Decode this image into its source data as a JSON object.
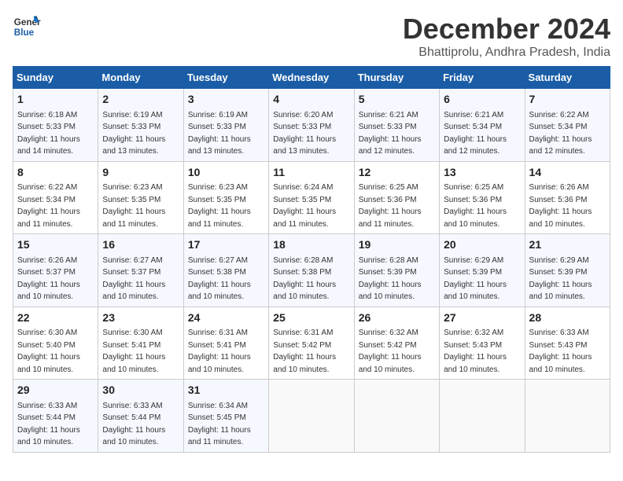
{
  "header": {
    "logo_general": "General",
    "logo_blue": "Blue",
    "month_title": "December 2024",
    "location": "Bhattiprolu, Andhra Pradesh, India"
  },
  "weekdays": [
    "Sunday",
    "Monday",
    "Tuesday",
    "Wednesday",
    "Thursday",
    "Friday",
    "Saturday"
  ],
  "weeks": [
    [
      {
        "day": "1",
        "sunrise": "Sunrise: 6:18 AM",
        "sunset": "Sunset: 5:33 PM",
        "daylight": "Daylight: 11 hours and 14 minutes."
      },
      {
        "day": "2",
        "sunrise": "Sunrise: 6:19 AM",
        "sunset": "Sunset: 5:33 PM",
        "daylight": "Daylight: 11 hours and 13 minutes."
      },
      {
        "day": "3",
        "sunrise": "Sunrise: 6:19 AM",
        "sunset": "Sunset: 5:33 PM",
        "daylight": "Daylight: 11 hours and 13 minutes."
      },
      {
        "day": "4",
        "sunrise": "Sunrise: 6:20 AM",
        "sunset": "Sunset: 5:33 PM",
        "daylight": "Daylight: 11 hours and 13 minutes."
      },
      {
        "day": "5",
        "sunrise": "Sunrise: 6:21 AM",
        "sunset": "Sunset: 5:33 PM",
        "daylight": "Daylight: 11 hours and 12 minutes."
      },
      {
        "day": "6",
        "sunrise": "Sunrise: 6:21 AM",
        "sunset": "Sunset: 5:34 PM",
        "daylight": "Daylight: 11 hours and 12 minutes."
      },
      {
        "day": "7",
        "sunrise": "Sunrise: 6:22 AM",
        "sunset": "Sunset: 5:34 PM",
        "daylight": "Daylight: 11 hours and 12 minutes."
      }
    ],
    [
      {
        "day": "8",
        "sunrise": "Sunrise: 6:22 AM",
        "sunset": "Sunset: 5:34 PM",
        "daylight": "Daylight: 11 hours and 11 minutes."
      },
      {
        "day": "9",
        "sunrise": "Sunrise: 6:23 AM",
        "sunset": "Sunset: 5:35 PM",
        "daylight": "Daylight: 11 hours and 11 minutes."
      },
      {
        "day": "10",
        "sunrise": "Sunrise: 6:23 AM",
        "sunset": "Sunset: 5:35 PM",
        "daylight": "Daylight: 11 hours and 11 minutes."
      },
      {
        "day": "11",
        "sunrise": "Sunrise: 6:24 AM",
        "sunset": "Sunset: 5:35 PM",
        "daylight": "Daylight: 11 hours and 11 minutes."
      },
      {
        "day": "12",
        "sunrise": "Sunrise: 6:25 AM",
        "sunset": "Sunset: 5:36 PM",
        "daylight": "Daylight: 11 hours and 11 minutes."
      },
      {
        "day": "13",
        "sunrise": "Sunrise: 6:25 AM",
        "sunset": "Sunset: 5:36 PM",
        "daylight": "Daylight: 11 hours and 10 minutes."
      },
      {
        "day": "14",
        "sunrise": "Sunrise: 6:26 AM",
        "sunset": "Sunset: 5:36 PM",
        "daylight": "Daylight: 11 hours and 10 minutes."
      }
    ],
    [
      {
        "day": "15",
        "sunrise": "Sunrise: 6:26 AM",
        "sunset": "Sunset: 5:37 PM",
        "daylight": "Daylight: 11 hours and 10 minutes."
      },
      {
        "day": "16",
        "sunrise": "Sunrise: 6:27 AM",
        "sunset": "Sunset: 5:37 PM",
        "daylight": "Daylight: 11 hours and 10 minutes."
      },
      {
        "day": "17",
        "sunrise": "Sunrise: 6:27 AM",
        "sunset": "Sunset: 5:38 PM",
        "daylight": "Daylight: 11 hours and 10 minutes."
      },
      {
        "day": "18",
        "sunrise": "Sunrise: 6:28 AM",
        "sunset": "Sunset: 5:38 PM",
        "daylight": "Daylight: 11 hours and 10 minutes."
      },
      {
        "day": "19",
        "sunrise": "Sunrise: 6:28 AM",
        "sunset": "Sunset: 5:39 PM",
        "daylight": "Daylight: 11 hours and 10 minutes."
      },
      {
        "day": "20",
        "sunrise": "Sunrise: 6:29 AM",
        "sunset": "Sunset: 5:39 PM",
        "daylight": "Daylight: 11 hours and 10 minutes."
      },
      {
        "day": "21",
        "sunrise": "Sunrise: 6:29 AM",
        "sunset": "Sunset: 5:39 PM",
        "daylight": "Daylight: 11 hours and 10 minutes."
      }
    ],
    [
      {
        "day": "22",
        "sunrise": "Sunrise: 6:30 AM",
        "sunset": "Sunset: 5:40 PM",
        "daylight": "Daylight: 11 hours and 10 minutes."
      },
      {
        "day": "23",
        "sunrise": "Sunrise: 6:30 AM",
        "sunset": "Sunset: 5:41 PM",
        "daylight": "Daylight: 11 hours and 10 minutes."
      },
      {
        "day": "24",
        "sunrise": "Sunrise: 6:31 AM",
        "sunset": "Sunset: 5:41 PM",
        "daylight": "Daylight: 11 hours and 10 minutes."
      },
      {
        "day": "25",
        "sunrise": "Sunrise: 6:31 AM",
        "sunset": "Sunset: 5:42 PM",
        "daylight": "Daylight: 11 hours and 10 minutes."
      },
      {
        "day": "26",
        "sunrise": "Sunrise: 6:32 AM",
        "sunset": "Sunset: 5:42 PM",
        "daylight": "Daylight: 11 hours and 10 minutes."
      },
      {
        "day": "27",
        "sunrise": "Sunrise: 6:32 AM",
        "sunset": "Sunset: 5:43 PM",
        "daylight": "Daylight: 11 hours and 10 minutes."
      },
      {
        "day": "28",
        "sunrise": "Sunrise: 6:33 AM",
        "sunset": "Sunset: 5:43 PM",
        "daylight": "Daylight: 11 hours and 10 minutes."
      }
    ],
    [
      {
        "day": "29",
        "sunrise": "Sunrise: 6:33 AM",
        "sunset": "Sunset: 5:44 PM",
        "daylight": "Daylight: 11 hours and 10 minutes."
      },
      {
        "day": "30",
        "sunrise": "Sunrise: 6:33 AM",
        "sunset": "Sunset: 5:44 PM",
        "daylight": "Daylight: 11 hours and 10 minutes."
      },
      {
        "day": "31",
        "sunrise": "Sunrise: 6:34 AM",
        "sunset": "Sunset: 5:45 PM",
        "daylight": "Daylight: 11 hours and 11 minutes."
      },
      null,
      null,
      null,
      null
    ]
  ]
}
